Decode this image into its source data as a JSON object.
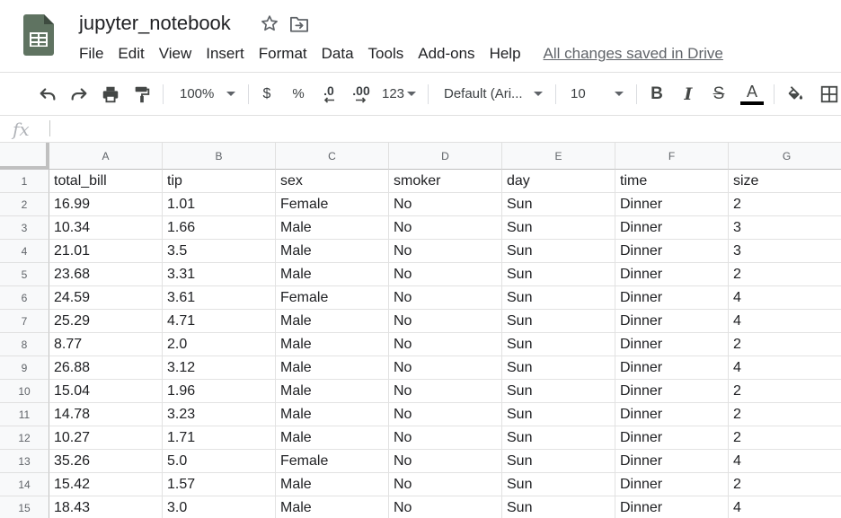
{
  "app": {
    "title": "jupyter_notebook",
    "saved_status": "All changes saved in Drive",
    "menu": [
      "File",
      "Edit",
      "View",
      "Insert",
      "Format",
      "Data",
      "Tools",
      "Add-ons",
      "Help"
    ]
  },
  "toolbar": {
    "zoom": "100%",
    "currency": "$",
    "percent": "%",
    "decrease_decimal": ".0",
    "increase_decimal": ".00",
    "more_formats": "123",
    "font": "Default (Ari...",
    "font_size": "10",
    "bold": "B",
    "italic": "I",
    "strikethrough": "S",
    "text_color": "A"
  },
  "formula_bar": {
    "fx": "fx",
    "value": ""
  },
  "grid": {
    "columns": [
      "A",
      "B",
      "C",
      "D",
      "E",
      "F",
      "G"
    ],
    "row_numbers": [
      "1",
      "2",
      "3",
      "4",
      "5",
      "6",
      "7",
      "8",
      "9",
      "10",
      "11",
      "12",
      "13",
      "14",
      "15"
    ],
    "rows": [
      [
        "total_bill",
        "tip",
        "sex",
        "smoker",
        "day",
        "time",
        "size"
      ],
      [
        "16.99",
        "1.01",
        "Female",
        "No",
        "Sun",
        "Dinner",
        "2"
      ],
      [
        "10.34",
        "1.66",
        "Male",
        "No",
        "Sun",
        "Dinner",
        "3"
      ],
      [
        "21.01",
        "3.5",
        "Male",
        "No",
        "Sun",
        "Dinner",
        "3"
      ],
      [
        "23.68",
        "3.31",
        "Male",
        "No",
        "Sun",
        "Dinner",
        "2"
      ],
      [
        "24.59",
        "3.61",
        "Female",
        "No",
        "Sun",
        "Dinner",
        "4"
      ],
      [
        "25.29",
        "4.71",
        "Male",
        "No",
        "Sun",
        "Dinner",
        "4"
      ],
      [
        "8.77",
        "2.0",
        "Male",
        "No",
        "Sun",
        "Dinner",
        "2"
      ],
      [
        "26.88",
        "3.12",
        "Male",
        "No",
        "Sun",
        "Dinner",
        "4"
      ],
      [
        "15.04",
        "1.96",
        "Male",
        "No",
        "Sun",
        "Dinner",
        "2"
      ],
      [
        "14.78",
        "3.23",
        "Male",
        "No",
        "Sun",
        "Dinner",
        "2"
      ],
      [
        "10.27",
        "1.71",
        "Male",
        "No",
        "Sun",
        "Dinner",
        "2"
      ],
      [
        "35.26",
        "5.0",
        "Female",
        "No",
        "Sun",
        "Dinner",
        "4"
      ],
      [
        "15.42",
        "1.57",
        "Male",
        "No",
        "Sun",
        "Dinner",
        "2"
      ],
      [
        "18.43",
        "3.0",
        "Male",
        "No",
        "Sun",
        "Dinner",
        "4"
      ]
    ]
  },
  "colors": {
    "brand": "#188038",
    "logo": "#5f7361",
    "text_color_bar": "#000000"
  }
}
